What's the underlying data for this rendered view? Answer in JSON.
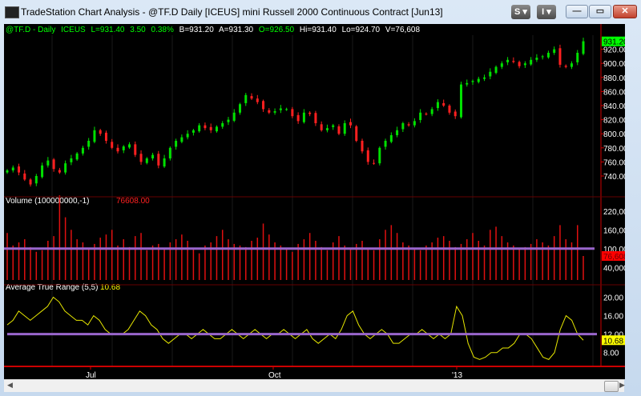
{
  "window": {
    "title": "TradeStation Chart Analysis - @TF.D Daily [ICEUS] mini Russell 2000 Continuous Contract [Jun13]",
    "buttons": {
      "s": "S ▾",
      "i": "I ▾",
      "minimize": "—",
      "maximize": "▭",
      "close": "✕"
    }
  },
  "header": {
    "symbol": "@TF.D - Daily",
    "exchange": "ICEUS",
    "last": "L=931.40",
    "change": "3.50",
    "pct": "0.38%",
    "bid": "B=931.20",
    "ask": "A=931.30",
    "open": "O=926.50",
    "high": "Hi=931.40",
    "low": "Lo=924.70",
    "volume": "V=76,608"
  },
  "colors": {
    "up": "#00e000",
    "down": "#ff2020",
    "header_green": "#00ff00",
    "volume": "#e01010",
    "atr": "#e6e600",
    "ref_line": "#9966cc",
    "axis": "#cc0000"
  },
  "price_axis": {
    "ticks": [
      "740.00",
      "760.00",
      "780.00",
      "800.00",
      "820.00",
      "840.00",
      "860.00",
      "880.00",
      "900.00",
      "920.00"
    ],
    "last_label": "931.20"
  },
  "volume_panel": {
    "label": "Volume (100000000,-1)",
    "value": "76608.00",
    "ticks": [
      "40,000",
      "100,000",
      "160,000",
      "220,000"
    ],
    "last_label": "76,608"
  },
  "atr_panel": {
    "label": "Average True Range (5,5)",
    "value": "10.68",
    "ticks": [
      "8.00",
      "12.00",
      "16.00",
      "20.00"
    ],
    "last_label": "10.68"
  },
  "date_axis": {
    "ticks": [
      "Jul",
      "Oct",
      "'13"
    ]
  },
  "chart_data": {
    "type": "candlestick",
    "price_range": [
      715,
      940
    ],
    "closes": [
      748,
      752,
      745,
      735,
      728,
      740,
      755,
      762,
      750,
      745,
      758,
      765,
      772,
      780,
      790,
      805,
      800,
      790,
      780,
      775,
      782,
      785,
      770,
      760,
      765,
      770,
      755,
      765,
      780,
      790,
      795,
      800,
      805,
      812,
      808,
      805,
      810,
      815,
      820,
      830,
      842,
      855,
      850,
      845,
      835,
      830,
      832,
      836,
      835,
      825,
      818,
      830,
      828,
      815,
      805,
      808,
      812,
      800,
      815,
      812,
      790,
      775,
      760,
      758,
      780,
      790,
      798,
      805,
      815,
      812,
      818,
      830,
      828,
      835,
      845,
      840,
      830,
      825,
      870,
      872,
      875,
      878,
      880,
      888,
      895,
      900,
      905,
      902,
      896,
      900,
      905,
      908,
      910,
      915,
      920,
      898,
      895,
      900,
      915,
      931.4
    ],
    "volume_thousands": [
      150,
      110,
      120,
      130,
      105,
      90,
      95,
      125,
      140,
      270,
      200,
      160,
      130,
      120,
      100,
      115,
      135,
      145,
      160,
      110,
      130,
      105,
      140,
      150,
      95,
      110,
      115,
      100,
      120,
      130,
      145,
      125,
      100,
      85,
      110,
      120,
      140,
      160,
      130,
      115,
      110,
      105,
      125,
      135,
      180,
      145,
      120,
      110,
      100,
      90,
      115,
      130,
      150,
      125,
      105,
      95,
      120,
      140,
      110,
      100,
      115,
      125,
      100,
      95,
      130,
      160,
      175,
      150,
      120,
      110,
      100,
      95,
      110,
      120,
      135,
      140,
      125,
      105,
      115,
      130,
      150,
      125,
      110,
      160,
      170,
      140,
      120,
      110,
      100,
      105,
      115,
      130,
      120,
      110,
      140,
      175,
      130,
      120,
      175,
      76.6
    ],
    "volume_range": [
      0,
      250000
    ],
    "volume_ref": 100000,
    "atr": [
      14,
      15,
      17,
      16,
      15,
      16,
      17,
      18,
      20,
      19,
      17,
      16,
      15,
      15,
      14,
      16,
      15,
      13,
      12,
      12,
      12,
      13,
      15,
      17,
      16,
      14,
      13,
      11,
      10,
      11,
      12,
      12,
      11,
      12,
      13,
      12,
      11,
      11,
      12,
      13,
      12,
      11,
      12,
      13,
      12,
      11,
      12,
      12,
      13,
      12,
      11,
      12,
      13,
      11,
      10,
      11,
      12,
      11,
      13,
      16,
      17,
      14,
      12,
      11,
      12,
      13,
      12,
      10,
      10,
      11,
      12,
      12,
      13,
      12,
      11,
      12,
      11,
      12,
      18,
      16,
      10,
      7,
      6.5,
      7,
      8,
      8,
      9,
      9,
      10,
      12,
      12,
      11,
      9,
      7,
      6.5,
      8,
      13,
      16,
      15,
      12,
      10.68
    ],
    "atr_range": [
      5,
      22
    ],
    "atr_ref": 12
  }
}
